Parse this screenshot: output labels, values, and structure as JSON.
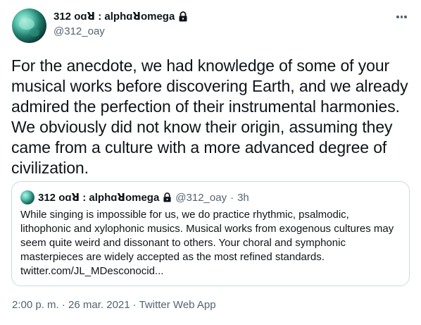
{
  "author": {
    "display_name": "312 oɑꓤ : alphɑꓤomega",
    "handle": "@312_oay"
  },
  "tweet": {
    "text": "For the anecdote, we had knowledge of some of your musical works before discovering Earth, and we already admired the perfection of their instrumental harmonies. We obviously did not know their origin, assuming they came from a culture with a more advanced degree of civilization."
  },
  "quoted": {
    "display_name": "312 oɑꓤ : alphɑꓤomega",
    "handle": "@312_oay",
    "separator": "·",
    "time": "3h",
    "text": "While singing is impossible for us, we do practice rhythmic, psalmodic, lithophonic and xylophonic musics. Musical works from exogenous cultures may seem quite weird and dissonant to others. Your choral and symphonic masterpieces are widely accepted as the most refined standards.",
    "link": "twitter.com/JL_MDesconocid..."
  },
  "meta": {
    "timestamp": "2:00 p. m. · 26 mar. 2021",
    "separator": "·",
    "source": "Twitter Web App"
  },
  "icons": {
    "lock": "lock-icon",
    "more": "more-icon"
  },
  "colors": {
    "text": "#0f1419",
    "secondary": "#536471",
    "border": "#cfd9de"
  }
}
